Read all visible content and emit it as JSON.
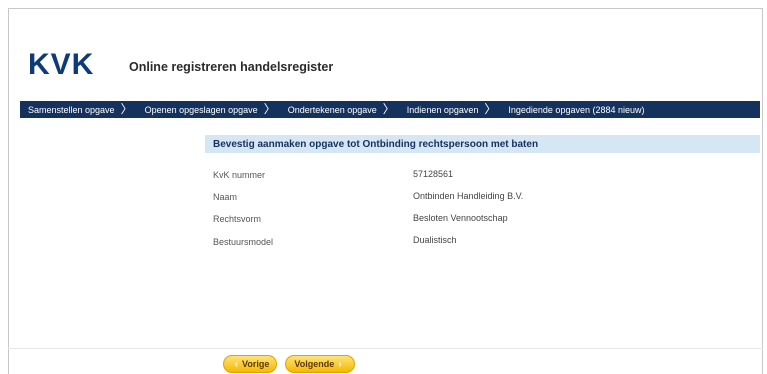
{
  "header": {
    "logo": "KVK",
    "title": "Online registreren handelsregister"
  },
  "nav": {
    "items": [
      {
        "label": "Samenstellen opgave"
      },
      {
        "label": "Openen opgeslagen opgave"
      },
      {
        "label": "Ondertekenen opgave"
      },
      {
        "label": "Indienen opgaven"
      },
      {
        "label": "Ingediende opgaven (2884 nieuw)"
      }
    ]
  },
  "panel": {
    "title": "Bevestig aanmaken opgave tot Ontbinding rechtspersoon met baten",
    "fields": [
      {
        "label": "KvK nummer",
        "value": "57128561"
      },
      {
        "label": "Naam",
        "value": "Ontbinden Handleiding B.V."
      },
      {
        "label": "Rechtsvorm",
        "value": "Besloten Vennootschap"
      },
      {
        "label": "Bestuursmodel",
        "value": "Dualistisch"
      }
    ]
  },
  "buttons": {
    "prev": "Vorige",
    "next": "Volgende"
  },
  "colors": {
    "brand": "#0b3c78",
    "navbar": "#15325e",
    "panel_header": "#d6e6f5",
    "button": "#f5b800"
  }
}
